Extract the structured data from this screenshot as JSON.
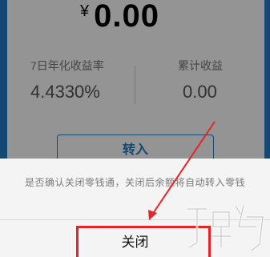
{
  "balance": {
    "currency_symbol": "¥",
    "amount": "0.00"
  },
  "stats": {
    "annual_yield_label": "7日年化收益率",
    "annual_yield_value": "4.4330%",
    "total_earnings_label": "累计收益",
    "total_earnings_value": "0.00"
  },
  "actions": {
    "transfer_in_label": "转入"
  },
  "action_sheet": {
    "message": "是否确认关闭零钱通，关闭后余额将自动转入零钱",
    "close_label": "关闭"
  },
  "colors": {
    "accent": "#1e7ec8",
    "annotation": "#e3262a",
    "overlay": "rgba(0,0,0,0.42)"
  }
}
